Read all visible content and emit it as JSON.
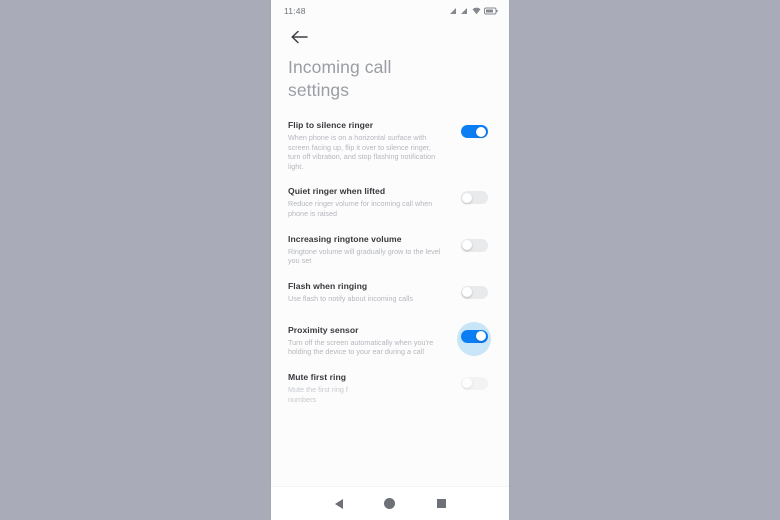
{
  "statusbar": {
    "time": "11:48",
    "icons": [
      "signal-icon",
      "signal-icon",
      "wifi-icon",
      "battery-icon"
    ]
  },
  "header": {
    "back_icon": "back-arrow-icon",
    "title": "Incoming call\nsettings"
  },
  "settings": [
    {
      "title": "Flip to silence ringer",
      "description": "When phone is on a horizontal surface with screen facing up, flip it over to silence ringer, turn off vibration, and stop flashing notification light.",
      "state": "on",
      "highlighted": false
    },
    {
      "title": "Quiet ringer when lifted",
      "description": "Reduce ringer volume for incoming call when phone is raised",
      "state": "off",
      "highlighted": false
    },
    {
      "title": "Increasing ringtone volume",
      "description": "Ringtone volume will gradually grow to the level you set",
      "state": "off",
      "highlighted": false
    },
    {
      "title": "Flash when ringing",
      "description": "Use flash to notify about incoming calls",
      "state": "off",
      "highlighted": false
    },
    {
      "title": "Proximity sensor",
      "description": "Turn off the screen automatically when you're holding the device to your ear during a call",
      "state": "on",
      "highlighted": true
    },
    {
      "title": "Mute first ring",
      "description": "Mute the first ring f\nnumbers",
      "state": "off",
      "highlighted": false
    }
  ],
  "navbar": {
    "back": "nav-back-icon",
    "home": "nav-home-icon",
    "recents": "nav-recents-icon"
  },
  "colors": {
    "toggle_on": "#0b7ef4",
    "toggle_off": "#e9eaec",
    "ripple": "#c9e6f8",
    "backdrop": "#a9acb8",
    "title_text": "#9a9da3",
    "item_title": "#37393d",
    "item_desc": "#b4b7bd"
  }
}
